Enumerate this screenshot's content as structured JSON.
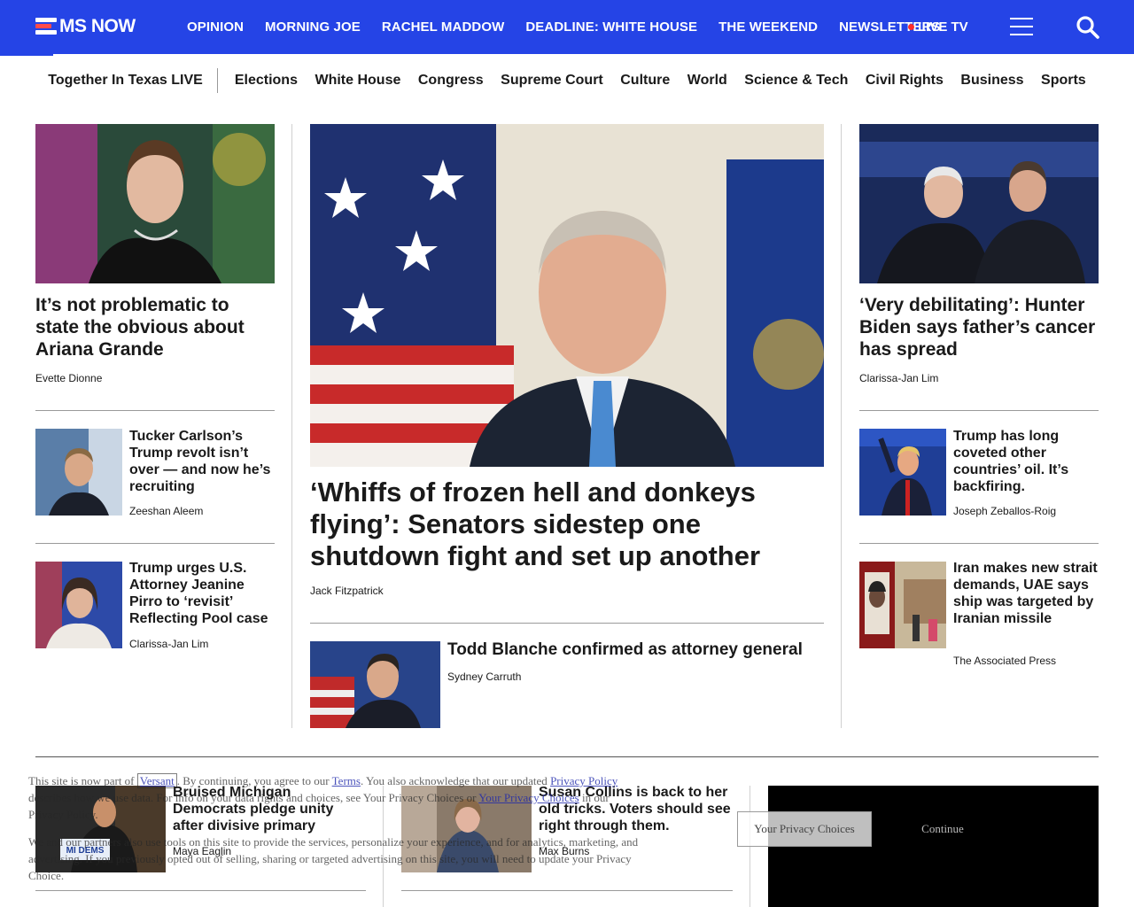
{
  "header": {
    "logo_text": "MS NOW",
    "nav": [
      "OPINION",
      "MORNING JOE",
      "RACHEL MADDOW",
      "DEADLINE: WHITE HOUSE",
      "THE WEEKEND",
      "NEWSLETTERS"
    ],
    "live_label": "LIVE TV",
    "brand_color": "#2544e6",
    "live_dot_color": "#ff2c2c"
  },
  "subnav": {
    "first": "Together In Texas LIVE",
    "items": [
      "Elections",
      "White House",
      "Congress",
      "Supreme Court",
      "Culture",
      "World",
      "Science & Tech",
      "Civil Rights",
      "Business",
      "Sports"
    ]
  },
  "left": {
    "lead": {
      "headline": "It’s not problematic to state the obvious about Ariana Grande",
      "author": "Evette Dionne"
    },
    "stories": [
      {
        "headline": "Tucker Carlson’s Trump revolt isn’t over — and now he’s recruiting",
        "author": "Zeeshan Aleem"
      },
      {
        "headline": "Trump urges U.S. Attorney Jeanine Pirro to ‘revisit’ Reflecting Pool case",
        "author": "Clarissa-Jan Lim"
      }
    ]
  },
  "center": {
    "lead": {
      "headline": "‘Whiffs of frozen hell and donkeys flying’: Senators sidestep one shutdown fight and set up another",
      "author": "Jack Fitzpatrick"
    },
    "story": {
      "headline": "Todd Blanche confirmed as attorney general",
      "author": "Sydney Carruth"
    }
  },
  "right": {
    "lead": {
      "headline": "‘Very debilitating’: Hunter Biden says father’s cancer has spread",
      "author": "Clarissa-Jan Lim"
    },
    "stories": [
      {
        "headline": "Trump has long coveted other countries’ oil. It’s backfiring.",
        "author": "Joseph Zeballos-Roig"
      },
      {
        "headline": "Iran makes new strait demands, UAE says ship was targeted by Iranian missile",
        "author": "The Associated Press"
      }
    ]
  },
  "bottom": {
    "stories": [
      {
        "headline": "Bruised Michigan Democrats pledge unity after divisive primary",
        "author": "Maya Eaglin",
        "sign_text": "MI DEMS"
      },
      {
        "headline": "Susan Collins is back to her old tricks. Voters should see right through them.",
        "author": "Max Burns"
      }
    ]
  },
  "cookie": {
    "t1": "This site is now part of ",
    "versant": "Versant",
    "t2": ". By continuing, you agree to our ",
    "terms": "Terms",
    "t3": ". You also acknowledge that our updated ",
    "privacy_policy": "Privacy Policy",
    "t4": " describes how we use data. For info on your data rights and choices, see Your Privacy Choices or ",
    "privacy_choices": "Your Privacy Choices",
    "t5": " in our Privacy Policy.",
    "t6": "We and our partners also use tools on this site to provide the services, personalize your experience, and for analytics, marketing, and advertising. If you previously opted out of selling, sharing or targeted advertising on this site, you will need to update your Privacy Choice.",
    "privacy_button": "Your Privacy Choices",
    "continue_button": "Continue"
  }
}
